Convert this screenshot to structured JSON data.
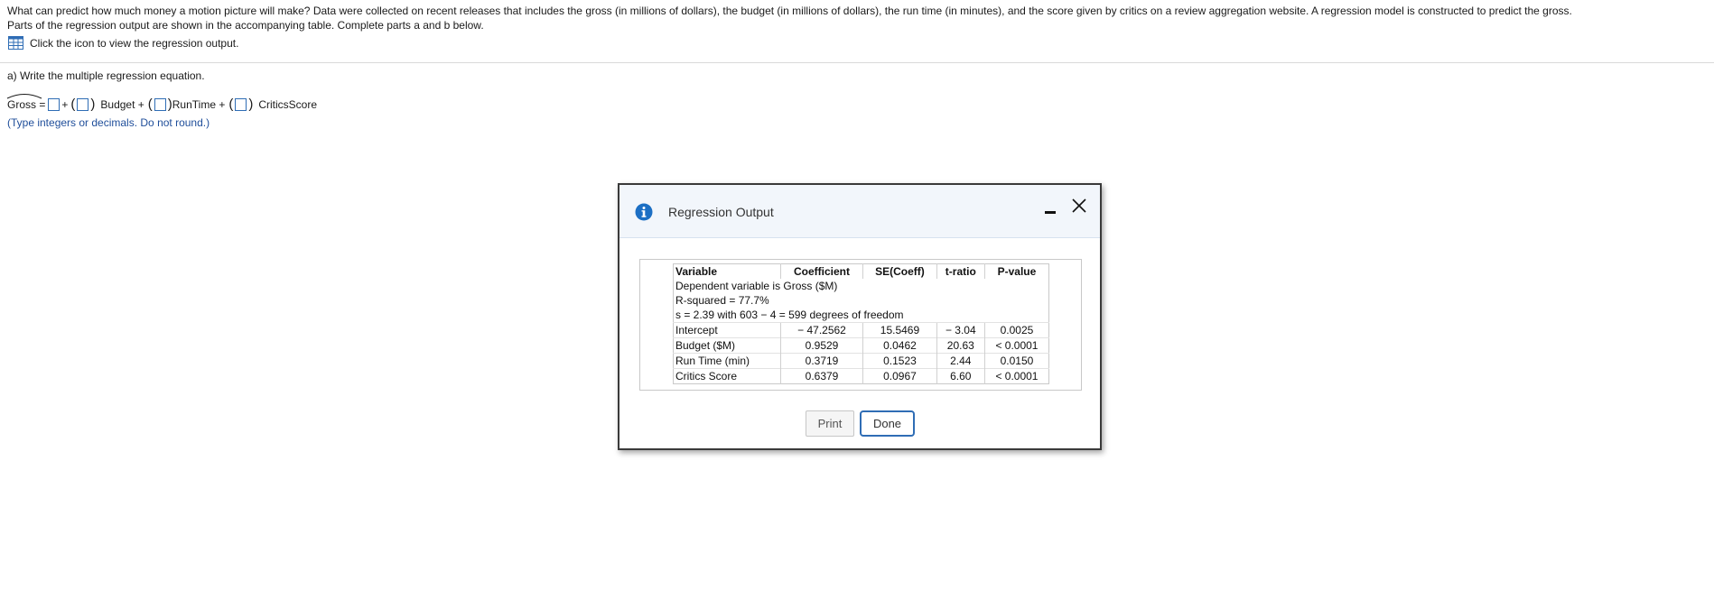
{
  "question": {
    "text_line1": "What can predict how much money a motion picture will make? Data were collected on recent releases that includes the gross (in millions of dollars), the budget (in millions of dollars), the run time (in minutes), and the score given by critics on a review aggregation website. A regression model is constructed to predict the gross.",
    "text_line2": "Parts of the regression output are shown in the accompanying table. Complete parts a and b below.",
    "view_link": "Click the icon to view the regression output."
  },
  "part_a": {
    "prompt": "a) Write the multiple regression equation.",
    "equation": {
      "lhs": "Gross",
      "equals": "=",
      "plus": "+",
      "term1": "Budget +",
      "term2": "RunTime +",
      "term3": "CriticsScore"
    },
    "hint": "(Type integers or decimals. Do not round.)"
  },
  "dialog": {
    "title": "Regression Output",
    "regression": {
      "dependent": "Dependent variable is Gross ($M)",
      "r_squared": "R-squared = 77.7%",
      "s_line": "s = 2.39 with 603 − 4 = 599 degrees of freedom",
      "columns": [
        "Variable",
        "Coefficient",
        "SE(Coeff)",
        "t-ratio",
        "P-value"
      ],
      "rows": [
        [
          "Intercept",
          "− 47.2562",
          "15.5469",
          "− 3.04",
          "0.0025"
        ],
        [
          "Budget ($M)",
          "0.9529",
          "0.0462",
          "20.63",
          "< 0.0001"
        ],
        [
          "Run Time (min)",
          "0.3719",
          "0.1523",
          "2.44",
          "0.0150"
        ],
        [
          "Critics Score",
          "0.6379",
          "0.0967",
          "6.60",
          "< 0.0001"
        ]
      ]
    },
    "print_label": "Print",
    "done_label": "Done"
  },
  "icons": {
    "view_link_icon": "table-grid-icon",
    "dialog_icon": "info-icon",
    "minimize": "minimize-icon",
    "close": "close-icon"
  },
  "colors": {
    "link_blue": "#1f4e9a",
    "accent_blue": "#2f6db5",
    "info_blue": "#1c6fc4"
  }
}
